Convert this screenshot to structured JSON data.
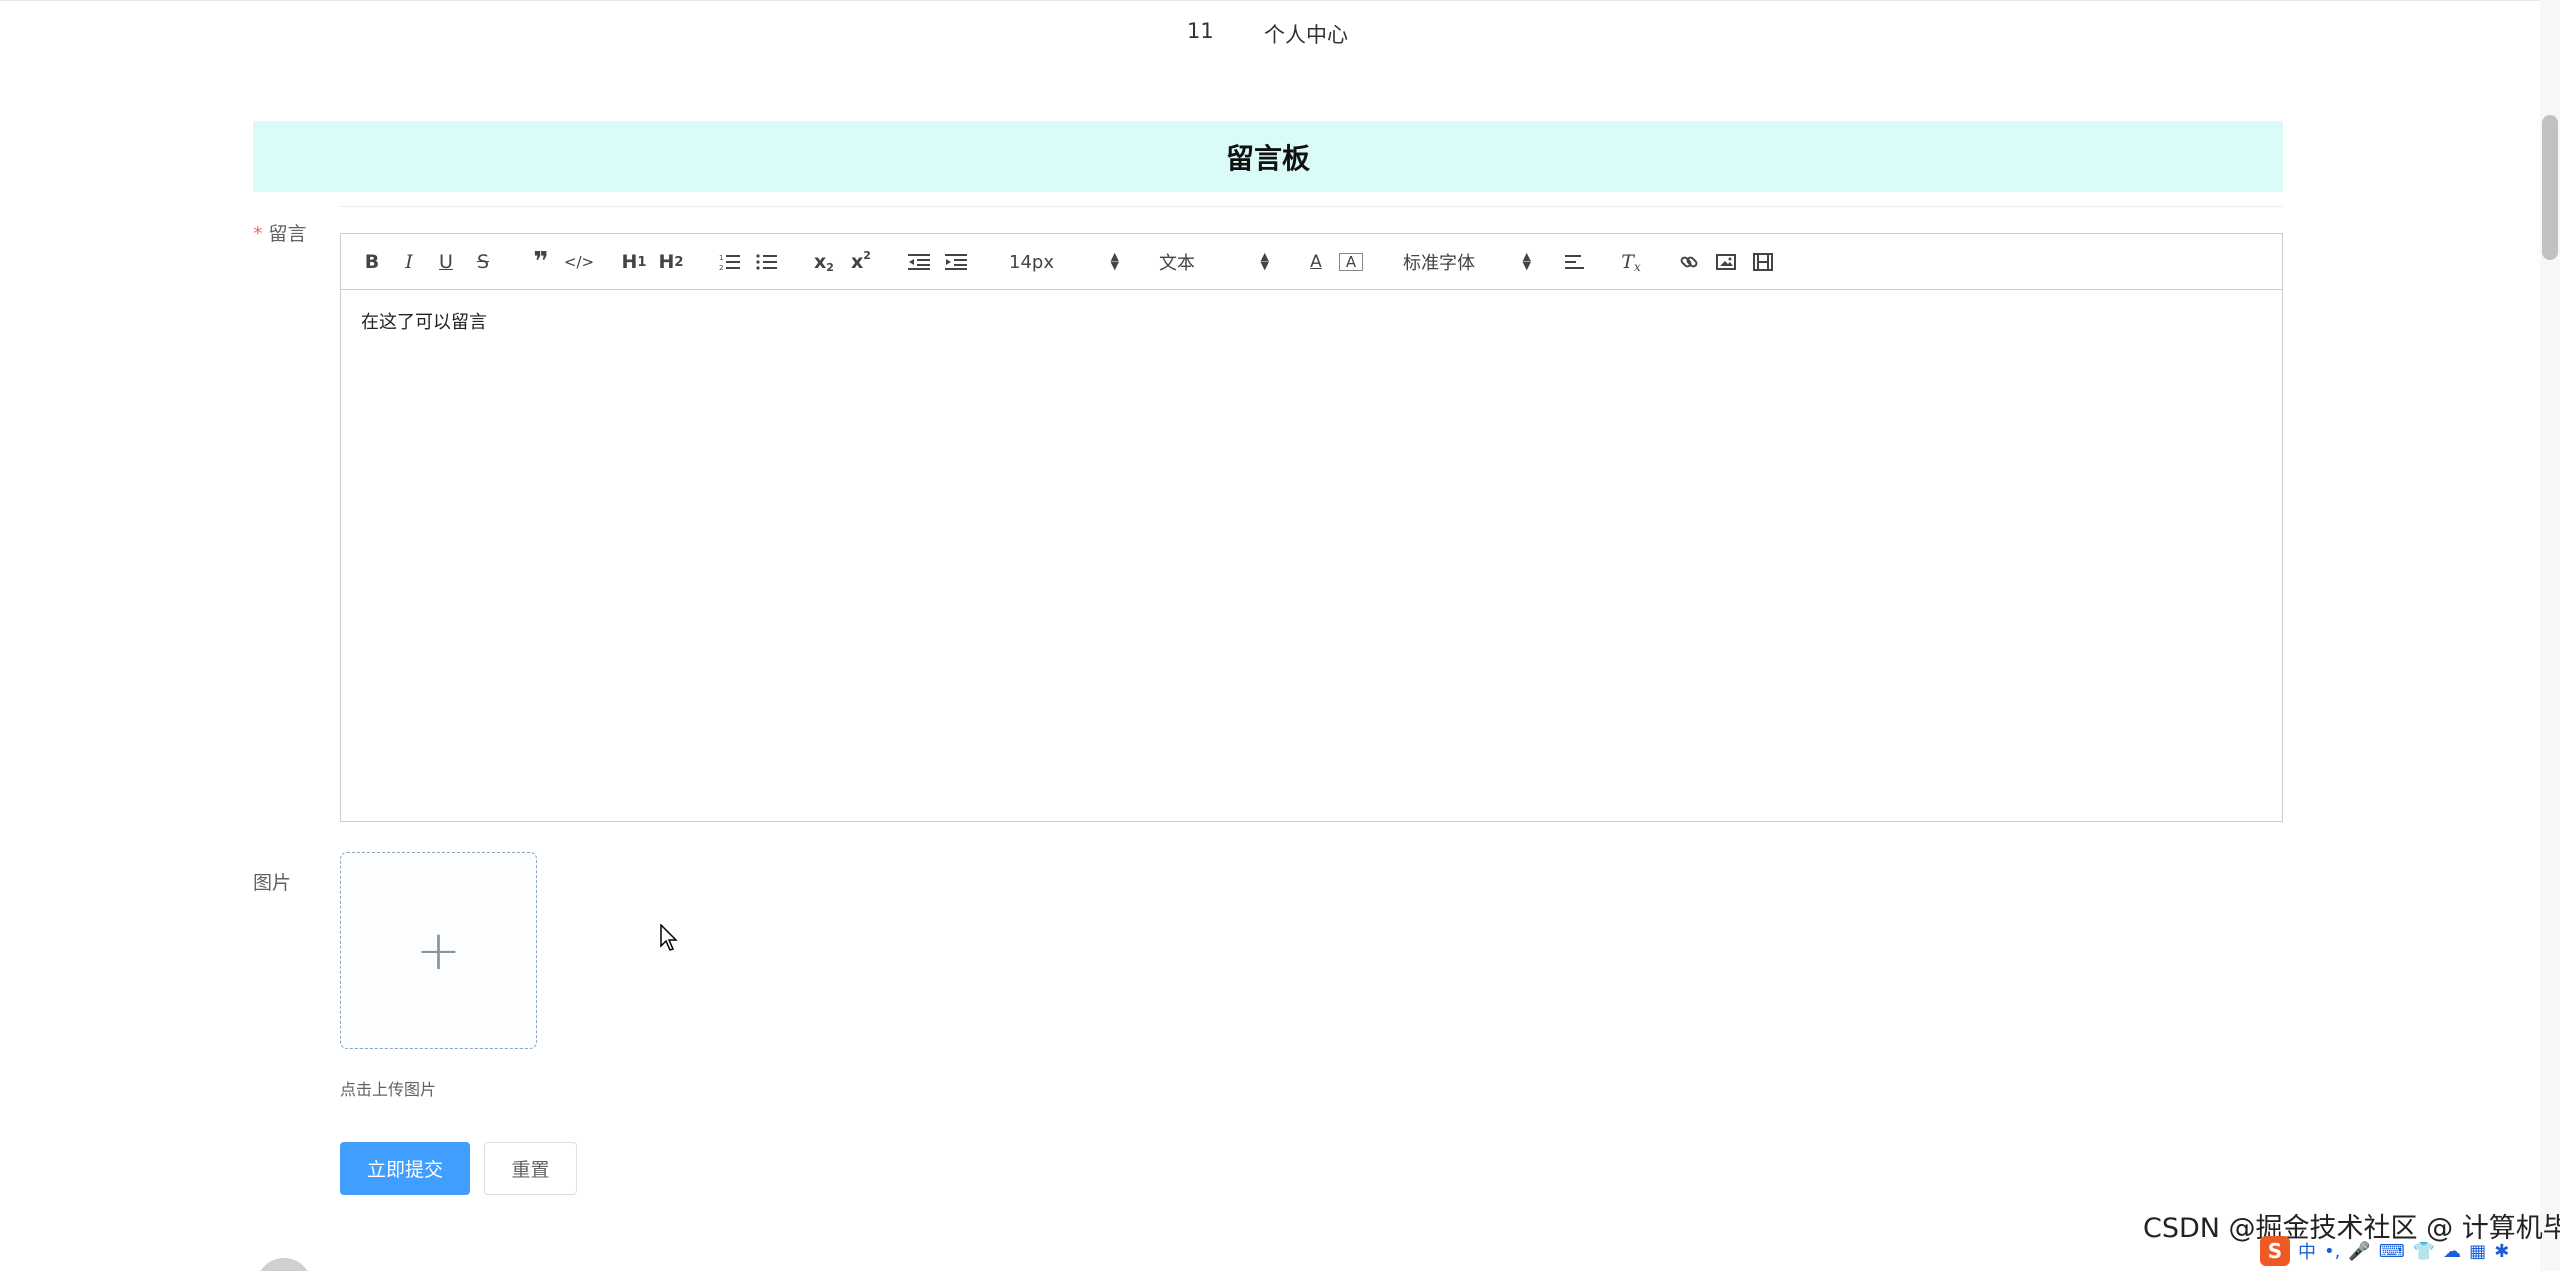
{
  "nav": {
    "item1": "11",
    "item2": "个人中心"
  },
  "banner": {
    "title": "留言板"
  },
  "form": {
    "message_label": "留言",
    "image_label": "图片",
    "upload_tip": "点击上传图片",
    "submit_label": "立即提交",
    "reset_label": "重置"
  },
  "editor": {
    "content": "在这了可以留言",
    "font_size": "14px",
    "block_type": "文本",
    "font_family": "标准字体",
    "tools": [
      "bold-icon",
      "italic-icon",
      "underline-icon",
      "strikethrough-icon",
      "blockquote-icon",
      "code-block-icon",
      "h1-icon",
      "h2-icon",
      "ordered-list-icon",
      "bullet-list-icon",
      "subscript-icon",
      "superscript-icon",
      "outdent-icon",
      "indent-icon",
      "font-color-icon",
      "background-color-icon",
      "align-icon",
      "clear-format-icon",
      "link-icon",
      "image-icon",
      "video-icon"
    ]
  },
  "upload": {
    "icon": "plus-icon"
  },
  "watermark": {
    "text": "CSDN @掘金技术社区 @ 计算机毕设小月哥"
  },
  "colors": {
    "primary": "#409eff",
    "banner_bg": "#dafbf8",
    "required": "#f56c6c"
  }
}
